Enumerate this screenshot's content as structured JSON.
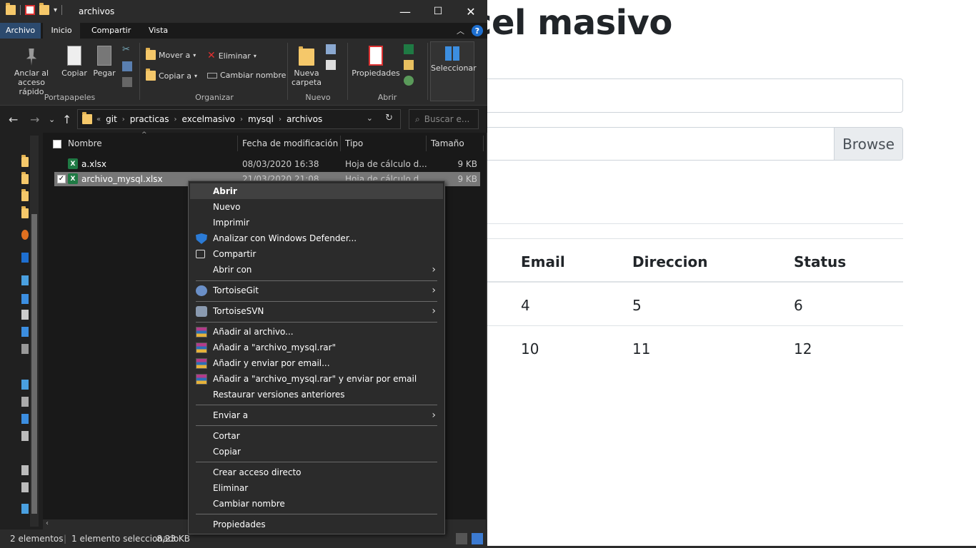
{
  "web": {
    "title": "cel masivo",
    "browse_label": "Browse",
    "table": {
      "headers": [
        "Email",
        "Direccion",
        "Status"
      ],
      "rows": [
        [
          "4",
          "5",
          "6"
        ],
        [
          "10",
          "11",
          "12"
        ]
      ]
    }
  },
  "explorer": {
    "title": "archivos",
    "tabs": [
      "Archivo",
      "Inicio",
      "Compartir",
      "Vista"
    ],
    "ribbon": {
      "anclar": "Anclar al acceso rápido",
      "copiar": "Copiar",
      "pegar": "Pegar",
      "portapapeles": "Portapapeles",
      "mover_a": "Mover a",
      "copiar_a": "Copiar a",
      "eliminar": "Eliminar",
      "cambiar_nombre": "Cambiar nombre",
      "organizar": "Organizar",
      "nueva_carpeta": "Nueva carpeta",
      "nuevo": "Nuevo",
      "propiedades": "Propiedades",
      "abrir": "Abrir",
      "seleccionar": "Seleccionar"
    },
    "address": {
      "overflow": "«",
      "crumbs": [
        "git",
        "practicas",
        "excelmasivo",
        "mysql",
        "archivos"
      ],
      "search_placeholder": "Buscar e..."
    },
    "columns": [
      "Nombre",
      "Fecha de modificación",
      "Tipo",
      "Tamaño"
    ],
    "files": [
      {
        "name": "a.xlsx",
        "date": "08/03/2020 16:38",
        "type": "Hoja de cálculo d...",
        "size": "9 KB"
      },
      {
        "name": "archivo_mysql.xlsx",
        "date": "21/03/2020 21:08",
        "type": "Hoja de cálculo d...",
        "size": "9 KB"
      }
    ],
    "status": {
      "count": "2 elementos",
      "selected": "1 elemento seleccionado",
      "size": "8,23 KB"
    }
  },
  "context_menu": {
    "items": [
      "Abrir",
      "Nuevo",
      "Imprimir",
      "Analizar con Windows Defender...",
      "Compartir",
      "Abrir con",
      "TortoiseGit",
      "TortoiseSVN",
      "Añadir al archivo...",
      "Añadir a \"archivo_mysql.rar\"",
      "Añadir y enviar por email...",
      "Añadir a \"archivo_mysql.rar\" y enviar por email",
      "Restaurar versiones anteriores",
      "Enviar a",
      "Cortar",
      "Copiar",
      "Crear acceso directo",
      "Eliminar",
      "Cambiar nombre",
      "Propiedades"
    ]
  },
  "colors": {
    "explorer_bg": "#202020",
    "menu_bg": "#2b2b2b",
    "selection": "#777777",
    "excel_green": "#1f7a44",
    "accent_blue": "#2c4a6e"
  }
}
